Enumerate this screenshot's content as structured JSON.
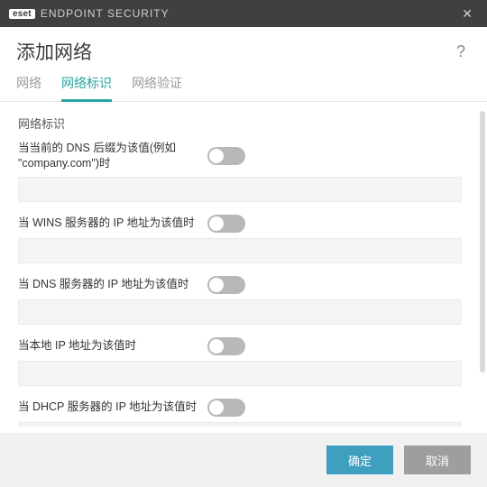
{
  "titlebar": {
    "brand": "eset",
    "product": "ENDPOINT SECURITY"
  },
  "header": {
    "title": "添加网络"
  },
  "tabs": {
    "items": [
      {
        "label": "网络",
        "name": "tab-network"
      },
      {
        "label": "网络标识",
        "name": "tab-network-id"
      },
      {
        "label": "网络验证",
        "name": "tab-network-auth"
      }
    ],
    "active_index": 1
  },
  "section": {
    "title": "网络标识"
  },
  "rows": [
    {
      "label": "当当前的 DNS 后缀为该值(例如 \"company.com\")时",
      "value": "",
      "name": "dns-suffix"
    },
    {
      "label": "当 WINS 服务器的 IP 地址为该值时",
      "value": "",
      "name": "wins-ip"
    },
    {
      "label": "当 DNS 服务器的 IP 地址为该值时",
      "value": "",
      "name": "dns-ip"
    },
    {
      "label": "当本地 IP 地址为该值时",
      "value": "",
      "name": "local-ip"
    },
    {
      "label": "当 DHCP 服务器的 IP 地址为该值时",
      "value": "",
      "name": "dhcp-ip"
    }
  ],
  "footer": {
    "ok": "确定",
    "cancel": "取消"
  }
}
